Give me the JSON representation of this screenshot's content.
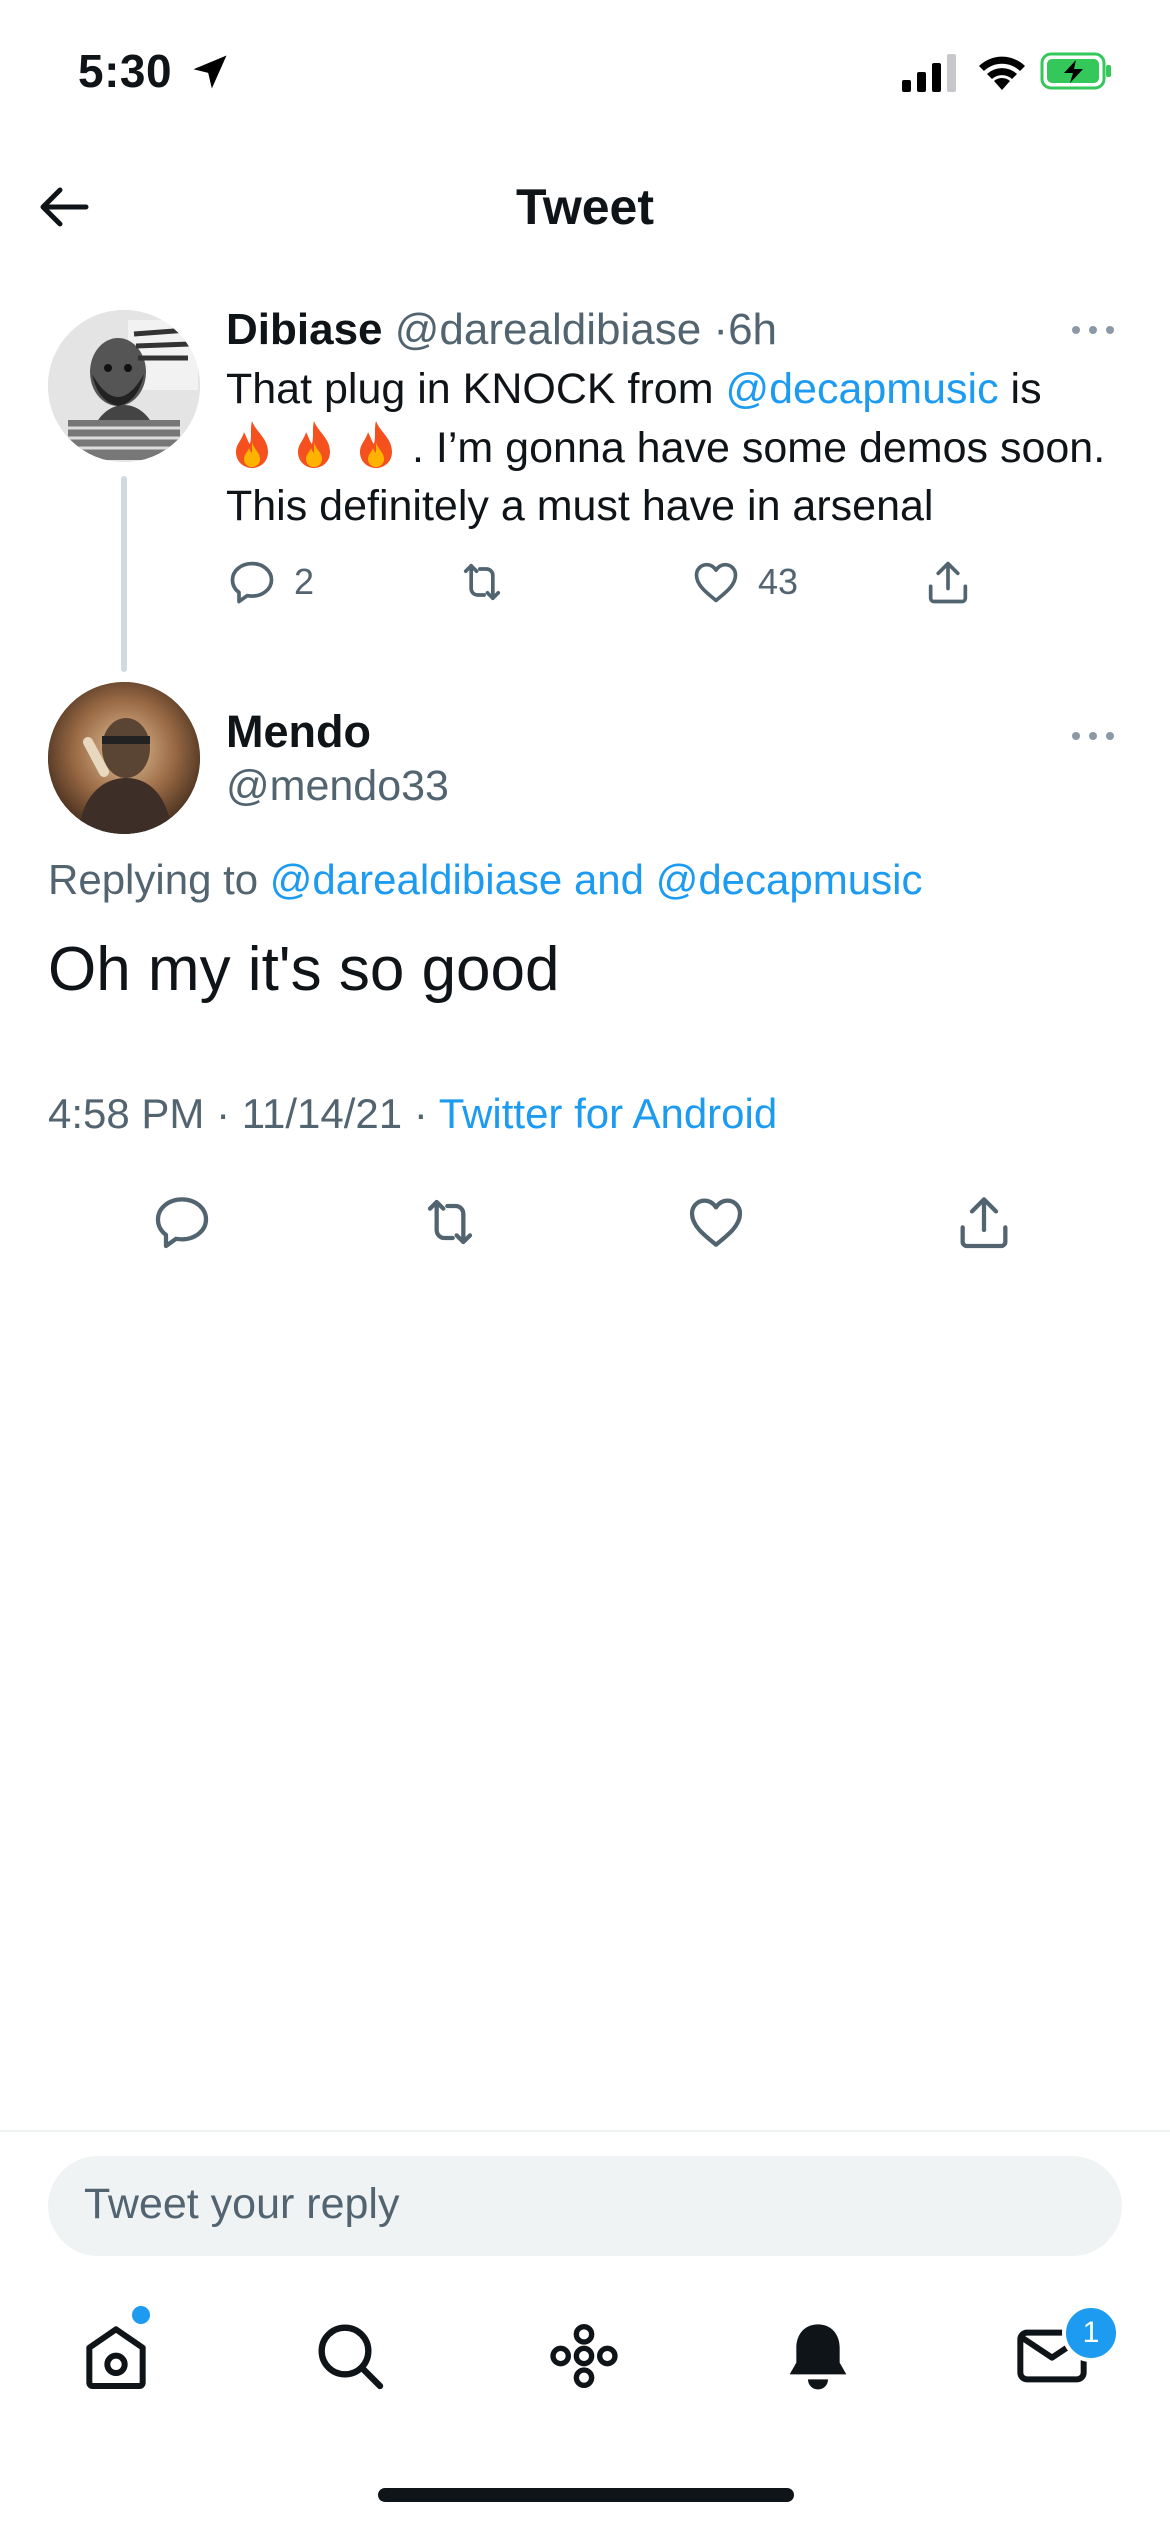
{
  "status_bar": {
    "time": "5:30"
  },
  "header": {
    "title": "Tweet"
  },
  "parent_tweet": {
    "name": "Dibiase",
    "handle": "@darealdibiase",
    "separator": "·",
    "time": "6h",
    "text_start": "That plug in KNOCK from ",
    "mention": "@decapmusic",
    "text_mid": " is",
    "text_end": ". I’m gonna have some demos soon. This definitely a must have in arsenal",
    "emoji": "fire-icon",
    "fire_count": 3,
    "replies": "2",
    "retweets": "",
    "likes": "43"
  },
  "main_tweet": {
    "name": "Mendo",
    "handle": "@mendo33",
    "replying_prefix": "Replying to ",
    "replying_to": "@darealdibiase and @decapmusic",
    "text": "Oh my it's so good",
    "time": "4:58 PM",
    "sep1": "·",
    "date": "11/14/21",
    "sep2": "·",
    "source": "Twitter for Android"
  },
  "reply_box": {
    "placeholder": "Tweet your reply"
  },
  "tab_bar": {
    "items": [
      "home-icon",
      "search-icon",
      "spaces-icon",
      "notifications-icon",
      "messages-icon"
    ],
    "messages_badge": "1"
  },
  "colors": {
    "accent": "#1d9bf0",
    "text": "#0f1419",
    "muted": "#536471"
  }
}
